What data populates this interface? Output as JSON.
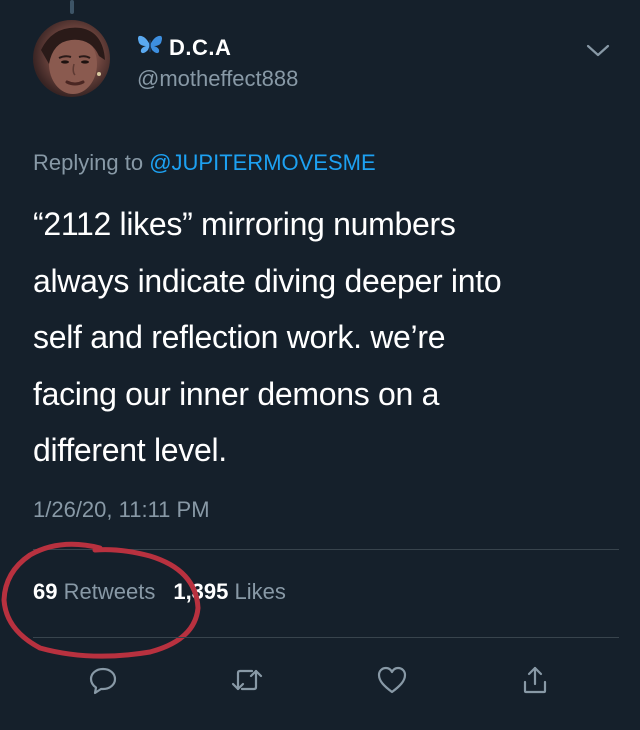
{
  "author": {
    "display_name": "D.C.A",
    "handle": "@motheffect888",
    "name_emoji_icon": "butterfly-icon"
  },
  "reply": {
    "prefix": "Replying to ",
    "mention": "@JUPITERMOVESME"
  },
  "tweet": {
    "text": "“2112 likes” mirroring numbers\nalways indicate diving deeper into\nself and reflection work. we’re\nfacing our inner demons on a\ndifferent level.",
    "timestamp": "1/26/20, 11:11 PM"
  },
  "stats": {
    "retweets_count": "69",
    "retweets_label": "Retweets",
    "likes_count": "1,395",
    "likes_label": "Likes"
  },
  "actions": [
    {
      "icon": "reply-icon"
    },
    {
      "icon": "retweet-icon"
    },
    {
      "icon": "heart-icon"
    },
    {
      "icon": "share-icon"
    }
  ],
  "colors": {
    "background": "#15202b",
    "secondary_text": "#8899a6",
    "link": "#1da1f2",
    "annotation": "#b8313f"
  }
}
